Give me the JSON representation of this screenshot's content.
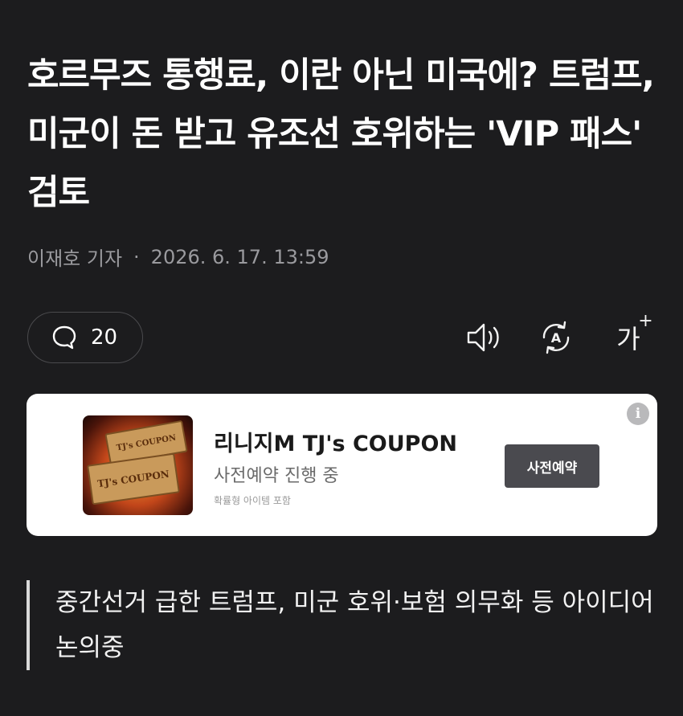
{
  "article": {
    "headline": "호르무즈 통행료, 이란 아닌 미국에? 트럼프, 미군이 돈 받고 유조선 호위하는 'VIP 패스' 검토",
    "reporter": "이재호 기자",
    "separator": "·",
    "date": "2026. 6. 17. 13:59",
    "subheading": "중간선거 급한 트럼프, 미군 호위·보험 의무화 등 아이디어 논의중"
  },
  "toolbar": {
    "comment_count": "20",
    "comment_icon": "speech-bubble-icon",
    "sound_icon": "speaker-icon",
    "translate_icon": "translate-icon",
    "font_size_label": "가",
    "font_size_plus": "+"
  },
  "ad": {
    "title": "리니지M TJ's COUPON",
    "subtitle": "사전예약 진행 중",
    "note": "확률형 아이템 포함",
    "button_label": "사전예약",
    "info_label": "i",
    "thumb_ticket_top": "TJ's COUPON",
    "thumb_ticket_bottom": "TJ's COUPON"
  },
  "colors": {
    "background": "#1c1c1e",
    "text": "#ffffff",
    "muted": "#9a9a9e",
    "ad_button": "#4a4a4f"
  }
}
